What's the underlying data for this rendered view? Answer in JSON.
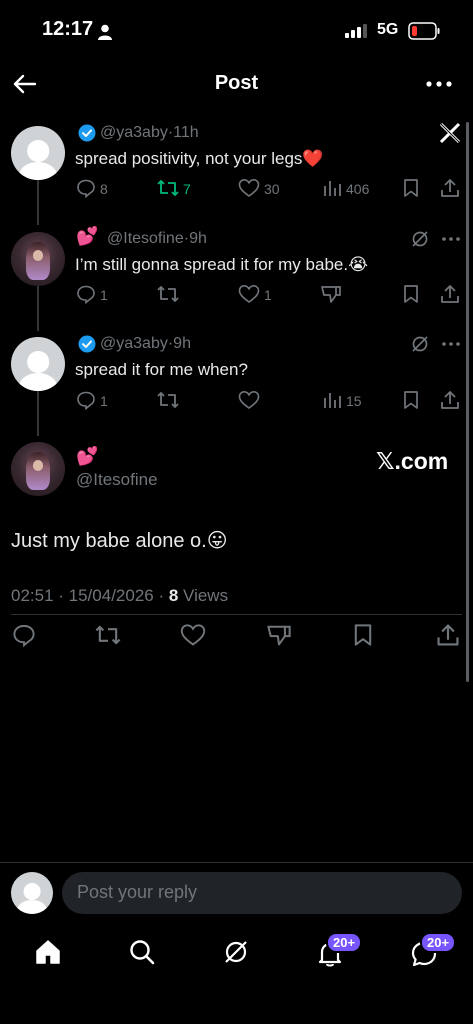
{
  "status_bar": {
    "time": "12:17",
    "network": "5G"
  },
  "header": {
    "title": "Post"
  },
  "replies": [
    {
      "handle": "@ya3aby",
      "sep": "·",
      "time": "11h",
      "text": "spread positivity, not your legs",
      "emoji": "❤️",
      "counts": {
        "replies": "8",
        "reposts": "7",
        "likes": "30",
        "views": "406"
      }
    },
    {
      "emoji_name": "💕",
      "handle": "@Itesofine",
      "sep": "·",
      "time": "9h",
      "text": "I’m still gonna spread it for my babe.",
      "emoji": "😭",
      "counts": {
        "replies": "1",
        "likes": "1"
      }
    },
    {
      "handle": "@ya3aby",
      "sep": "·",
      "time": "9h",
      "text": "spread it for me when?",
      "counts": {
        "replies": "1",
        "views": "15"
      }
    }
  ],
  "main_post": {
    "emoji_name": "💕",
    "handle": "@Itesofine",
    "watermark": "𝕏.com",
    "text": "Just my babe alone o.",
    "emoji": "😛",
    "timestamp": "02:51 · 15/04/2026 · ",
    "views_count": "8",
    "views_label": " Views"
  },
  "reply_bar": {
    "placeholder": "Post your reply"
  },
  "bottom_nav": {
    "notifications_badge": "20+",
    "messages_badge": "20+"
  },
  "colors": {
    "accent": "#1d9bf0",
    "repost_green": "#00ba7c",
    "badge_purple": "#7856ff",
    "heart_red": "#e0245e"
  }
}
